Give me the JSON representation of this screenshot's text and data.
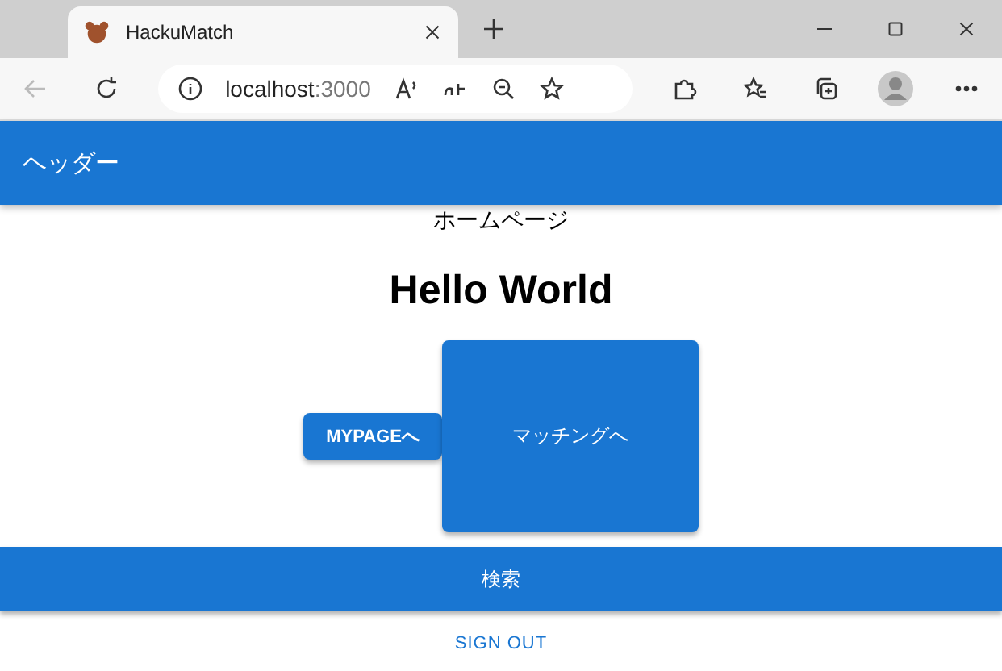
{
  "browser": {
    "tab": {
      "title": "HackuMatch",
      "selected": true
    },
    "address": {
      "host": "localhost",
      "port": ":3000"
    }
  },
  "app_bar": {
    "title": "ヘッダー"
  },
  "page": {
    "caption": "ホームページ",
    "heading": "Hello World",
    "buttons": [
      {
        "label": "MYPAGEへ",
        "kind": "small"
      },
      {
        "label": "マッチングへ",
        "kind": "large"
      }
    ],
    "search_button": "検索",
    "sign_out": "SIGN OUT"
  }
}
